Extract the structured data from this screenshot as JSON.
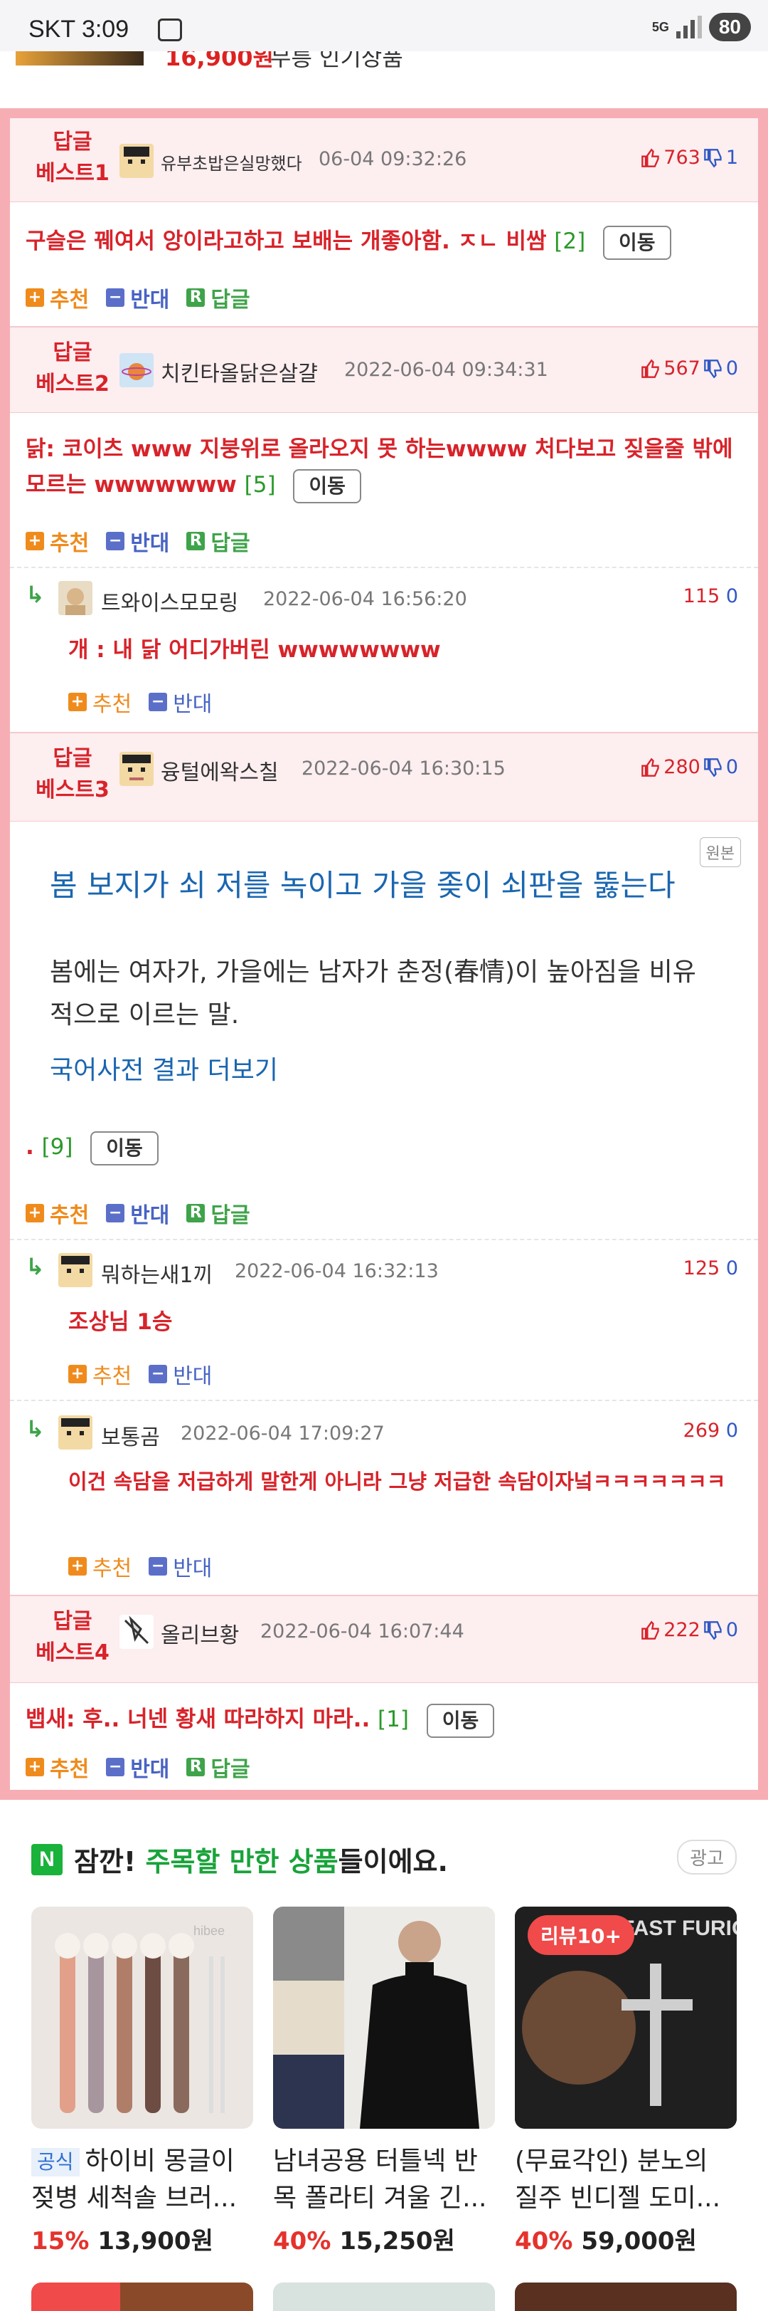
{
  "status_bar": {
    "carrier_time": "SKT 3:09",
    "network": "5G",
    "battery": "80"
  },
  "top_strip": {
    "price": "16,900원",
    "label": "무릉 인기상품"
  },
  "best_comments": [
    {
      "badge_line1": "답글",
      "badge_line2": "베스트1",
      "author": "유부초밥은실망했다",
      "date": "06-04 09:32:26",
      "up": "763",
      "down": "1",
      "text": "구슬은 꿰여서 앙이라고하고 보배는 개좋아함. ㅈㄴ 비쌈",
      "reply_count": "[2]",
      "move_label": "이동"
    },
    {
      "badge_line1": "답글",
      "badge_line2": "베스트2",
      "author": "치킨타올닭은살걀",
      "date": "2022-06-04 09:34:31",
      "up": "567",
      "down": "0",
      "text": "닭: 코이츠 www 지붕위로 올라오지 못 하는wwww 처다보고 짖을줄 밖에 모르는 wwwwwww",
      "reply_count": "[5]",
      "move_label": "이동"
    },
    {
      "badge_line1": "답글",
      "badge_line2": "베스트3",
      "author": "융털에왁스칠",
      "date": "2022-06-04 16:30:15",
      "up": "280",
      "down": "0",
      "text": ".",
      "reply_count": "[9]",
      "move_label": "이동"
    },
    {
      "badge_line1": "답글",
      "badge_line2": "베스트4",
      "author": "올리브황",
      "date": "2022-06-04 16:07:44",
      "up": "222",
      "down": "0",
      "text": "뱁새: 후.. 너넨 황새 따라하지 마라..",
      "reply_count": "[1]",
      "move_label": "이동"
    }
  ],
  "replies": [
    {
      "author": "트와이스모모링",
      "date": "2022-06-04 16:56:20",
      "up": "115",
      "down": "0",
      "text": "개 : 내 닭 어디가버린 wwwwwwww"
    },
    {
      "author": "뭐하는새1끼",
      "date": "2022-06-04 16:32:13",
      "up": "125",
      "down": "0",
      "text": "조상님 1승"
    },
    {
      "author": "보통곰",
      "date": "2022-06-04 17:09:27",
      "up": "269",
      "down": "0",
      "text": "이건 속담을 저급하게 말한게 아니라 그냥 저급한 속담이자넠ㅋㅋㅋㅋㅋㅋㅋㅋㅋㅋㅋㅋㅋㅋㅋㅋㅋ"
    }
  ],
  "actions": {
    "recommend": "추천",
    "oppose": "반대",
    "reply": "답글"
  },
  "dictionary_card": {
    "original_label": "원본",
    "title": "봄 보지가 쇠 저를 녹이고 가을 좆이 쇠판을 뚫는다",
    "description": "봄에는 여자가, 가을에는 남자가 춘정(春情)이 높아짐을 비유적으로 이르는 말.",
    "more_link": "국어사전 결과 더보기"
  },
  "ad": {
    "logo": "N",
    "heading_prefix": "잠깐! ",
    "heading_highlight": "주목할 만한 상품",
    "heading_suffix": "들이에요.",
    "ad_label": "광고",
    "products": [
      {
        "tag": "공식",
        "name": "하이비 몽글이 젖병 세척솔 브러...",
        "discount": "15%",
        "price": "13,900원"
      },
      {
        "tag": "",
        "name": "남녀공용 터틀넥 반목 폴라티 겨울 긴...",
        "discount": "40%",
        "price": "15,250원"
      },
      {
        "tag": "",
        "badge": "리뷰10+",
        "name": "(무료각인) 분노의 질주 빈디젤 도미...",
        "discount": "40%",
        "price": "59,000원"
      }
    ],
    "product1_brand": "hibee",
    "product3_poster": "FAST FURIOUS"
  },
  "colors": {
    "frame": "#f6aeb4",
    "best_red": "#d8232a",
    "down_blue": "#2f58c4",
    "recommend_orange": "#ef8b1c",
    "reply_green": "#3fa34a"
  }
}
